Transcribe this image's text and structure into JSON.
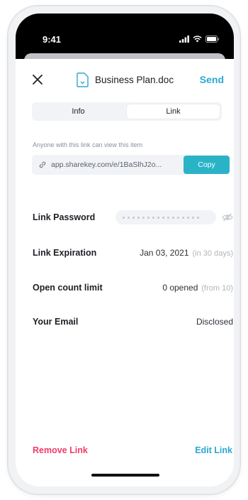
{
  "status_bar": {
    "time": "9:41"
  },
  "header": {
    "close_icon": "close-icon",
    "doc_icon": "document-icon",
    "title": "Business Plan.doc",
    "send_label": "Send"
  },
  "tabs": [
    {
      "label": "Info",
      "active": false
    },
    {
      "label": "Link",
      "active": true
    }
  ],
  "link": {
    "notice": "Anyone with this link can view this item",
    "url": "app.sharekey.com/e/1BaSlhJ2o...",
    "copy_label": "Copy"
  },
  "settings": {
    "password": {
      "label": "Link Password",
      "icon": "eye-off-icon"
    },
    "expiration": {
      "label": "Link Expiration",
      "value": "Jan 03, 2021",
      "sub": "(in 30 days)"
    },
    "open_count": {
      "label": "Open count limit",
      "value": "0 opened",
      "sub": "(from 10)"
    },
    "email": {
      "label": "Your Email",
      "value": "Disclosed"
    }
  },
  "footer": {
    "remove_label": "Remove Link",
    "edit_label": "Edit Link"
  },
  "colors": {
    "accent": "#2aa7d3",
    "copy_button": "#2ab3c7",
    "danger": "#ef3c6a"
  }
}
